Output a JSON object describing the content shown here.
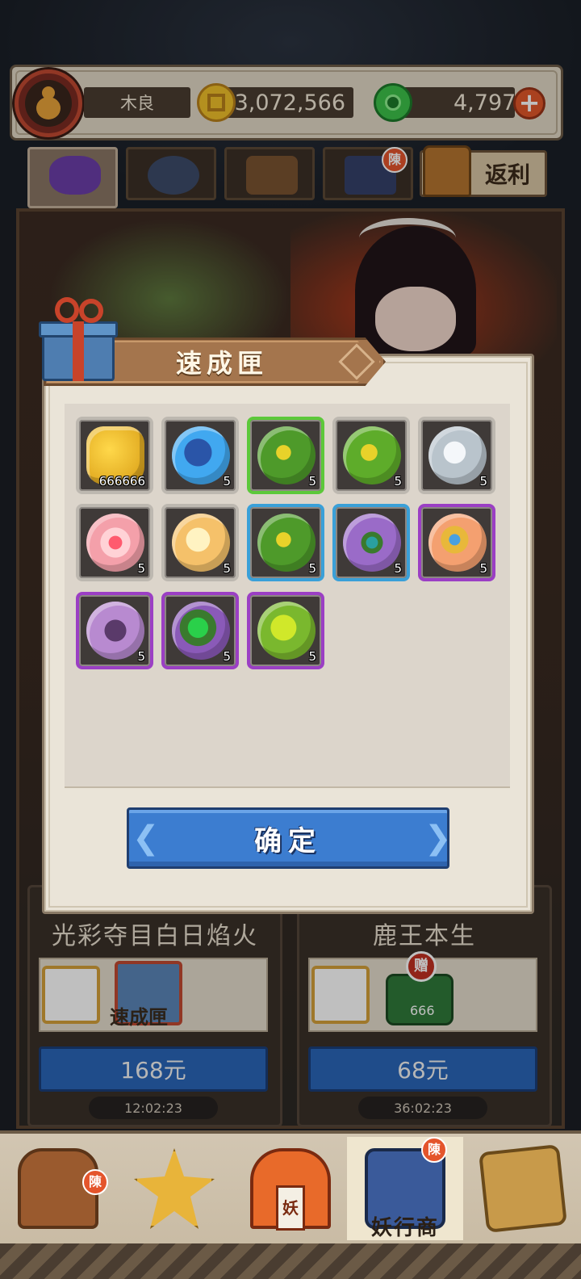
{
  "player": {
    "name": "木良"
  },
  "currency": {
    "gold": "3,072,566",
    "jade": "4,797",
    "add_label": "+"
  },
  "tabs": {
    "badge_text": "陳",
    "rebate_label": "返利"
  },
  "modal": {
    "title": "速成匣",
    "confirm_label": "确定",
    "items": [
      {
        "icon": "coin-string-icon",
        "count": "666666",
        "rarity": "gray"
      },
      {
        "icon": "blue-orb-icon",
        "count": "5",
        "rarity": "gray"
      },
      {
        "icon": "green-clover-orb-icon",
        "count": "5",
        "rarity": "green"
      },
      {
        "icon": "green-clover-orb-icon",
        "count": "5",
        "rarity": "gray"
      },
      {
        "icon": "sword-orb-icon",
        "count": "5",
        "rarity": "gray"
      },
      {
        "icon": "heart-orb-icon",
        "count": "5",
        "rarity": "gray"
      },
      {
        "icon": "golden-swirl-orb-icon",
        "count": "5",
        "rarity": "gray"
      },
      {
        "icon": "green-clover-orb-icon",
        "count": "5",
        "rarity": "blue"
      },
      {
        "icon": "peacock-feather-orb-icon",
        "count": "5",
        "rarity": "blue"
      },
      {
        "icon": "gem-cushion-orb-icon",
        "count": "5",
        "rarity": "purple"
      },
      {
        "icon": "demon-mask-orb-icon",
        "count": "5",
        "rarity": "purple"
      },
      {
        "icon": "peacock-eyes-orb-icon",
        "count": "5",
        "rarity": "purple"
      },
      {
        "icon": "green-dice-orb-icon",
        "count": "5",
        "rarity": "purple"
      }
    ]
  },
  "offers": [
    {
      "title": "光彩夺目白日焰火",
      "item_label": "速成匣",
      "price": "168元",
      "timer": "12:02:23"
    },
    {
      "title": "鹿王本生",
      "gift_badge": "赠",
      "item_count": "666",
      "price": "68元",
      "timer": "36:02:23"
    }
  ],
  "bottom_nav": {
    "active_label": "妖行商",
    "plaque_text": "妖",
    "badge_text": "陳"
  }
}
